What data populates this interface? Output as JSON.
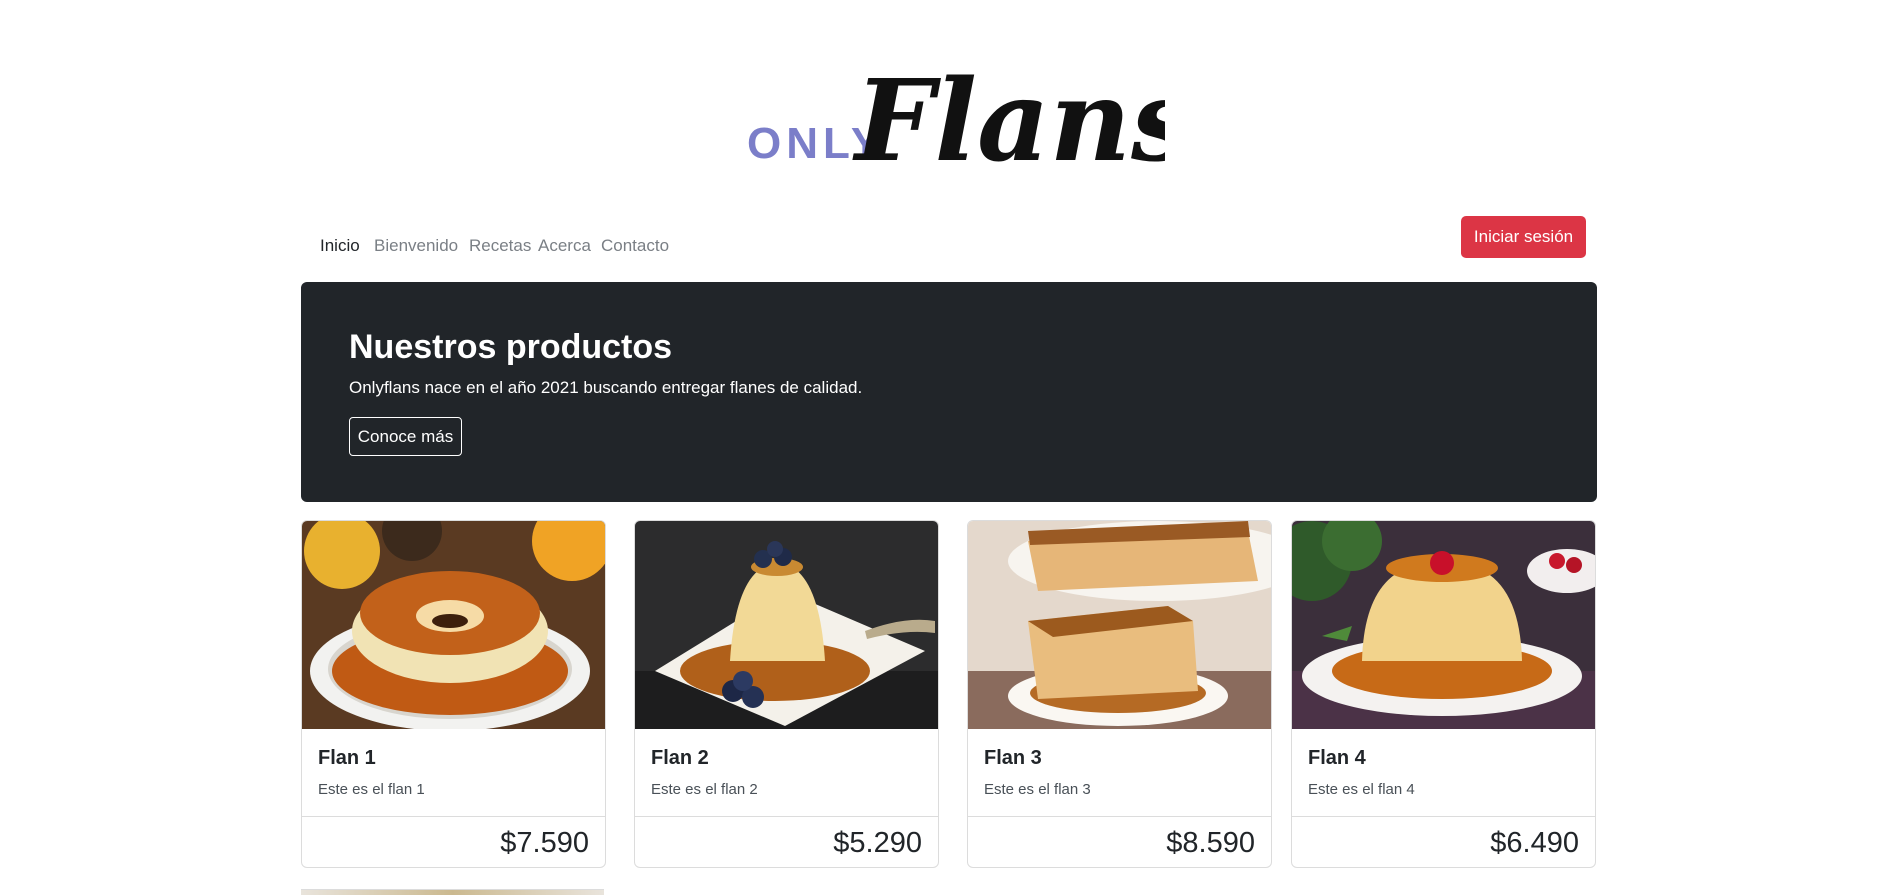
{
  "brand": {
    "word_small": "ONLY",
    "word_script": "Flans",
    "small_color": "#7b7ec9"
  },
  "nav": {
    "items": [
      {
        "label": "Inicio",
        "active": true
      },
      {
        "label": "Bienvenido",
        "active": false
      },
      {
        "label": "Recetas",
        "active": false
      },
      {
        "label": "Acerca",
        "active": false
      },
      {
        "label": "Contacto",
        "active": false
      }
    ],
    "login_label": "Iniciar sesión"
  },
  "hero": {
    "title": "Nuestros productos",
    "text": "Onlyflans nace en el año 2021 buscando entregar flanes de calidad.",
    "button_label": "Conoce más"
  },
  "products": [
    {
      "title": "Flan 1",
      "text": "Este es el flan 1",
      "price": "$7.590",
      "image": "ring-flan-photo"
    },
    {
      "title": "Flan 2",
      "text": "Este es el flan 2",
      "price": "$5.290",
      "image": "blueberry-flan-photo"
    },
    {
      "title": "Flan 3",
      "text": "Este es el flan 3",
      "price": "$8.590",
      "image": "flan-slice-photo"
    },
    {
      "title": "Flan 4",
      "text": "Este es el flan 4",
      "price": "$6.490",
      "image": "cherry-flan-photo"
    }
  ],
  "colors": {
    "primary_danger": "#dc3545",
    "hero_bg": "#212529",
    "caramel": "#b8621a",
    "custard": "#f3dba0"
  }
}
